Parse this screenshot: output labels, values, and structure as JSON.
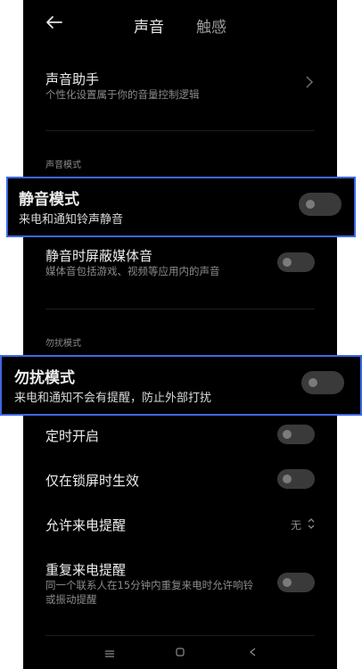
{
  "header": {
    "back_icon": "arrow-left-icon",
    "tabs": [
      {
        "label": "声音",
        "active": true
      },
      {
        "label": "触感",
        "active": false
      }
    ]
  },
  "sound_assistant": {
    "title": "声音助手",
    "subtitle": "个性化设置属于你的音量控制逻辑"
  },
  "section_sound_mode": "声音模式",
  "silent_mode": {
    "title": "静音模式",
    "subtitle": "来电和通知铃声静音",
    "enabled": false
  },
  "mute_media": {
    "title": "静音时屏蔽媒体音",
    "subtitle": "媒体音包括游戏、视频等应用内的声音",
    "enabled": false
  },
  "section_dnd": "勿扰模式",
  "dnd_mode": {
    "title": "勿扰模式",
    "subtitle": "来电和通知不会有提醒，防止外部打扰",
    "enabled": false
  },
  "scheduled": {
    "title": "定时开启",
    "enabled": false
  },
  "lockscreen_only": {
    "title": "仅在锁屏时生效",
    "enabled": false
  },
  "allow_calls": {
    "title": "允许来电提醒",
    "value": "无"
  },
  "repeat_calls": {
    "title": "重复来电提醒",
    "subtitle_line1": "同一个联系人在15分钟内重复来电时允许响铃",
    "subtitle_line2": "或振动提醒",
    "enabled": false
  },
  "navbar": {
    "menu_icon": "menu-icon",
    "home_icon": "home-icon",
    "back_icon": "back-triangle-icon"
  },
  "colors": {
    "background": "#000000",
    "highlight_border": "#3d67e6",
    "toggle_off": "#3a3a3a"
  }
}
